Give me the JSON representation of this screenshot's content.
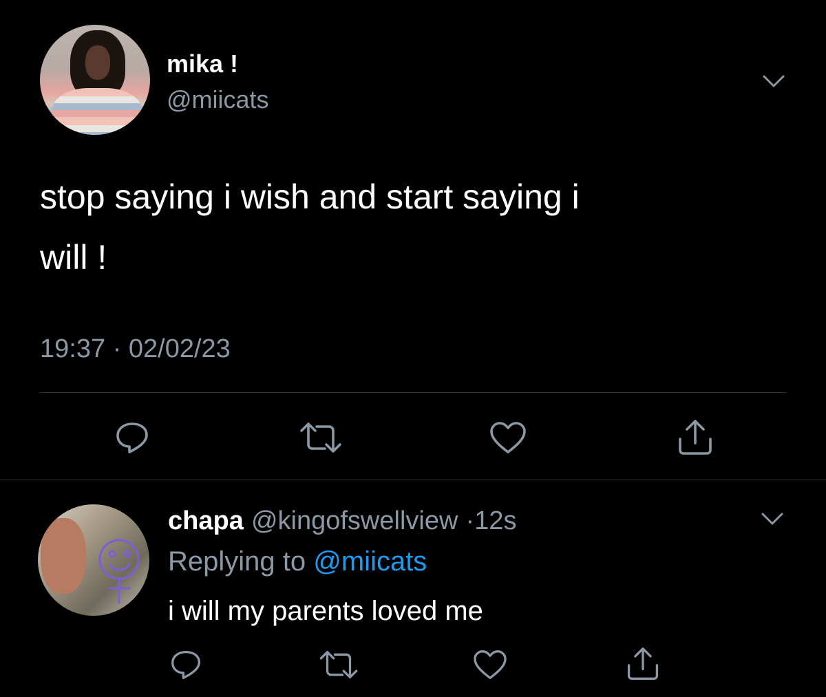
{
  "tweet": {
    "author_name": "mika !",
    "author_handle": "@miicats",
    "text_line1": "stop saying i wish and start saying i",
    "text_line2": "will !",
    "timestamp": "19:37 · 02/02/23"
  },
  "reply": {
    "author_name": "chapa",
    "author_handle": "@kingofswellview",
    "time_separator": "·",
    "time_ago": "12s",
    "replying_prefix": "Replying to",
    "replying_handle": "@miicats",
    "text": "i will my parents loved me"
  },
  "icons": {
    "reply": "reply-icon",
    "retweet": "retweet-icon",
    "like": "heart-icon",
    "share": "share-icon",
    "more": "chevron-down-icon"
  },
  "colors": {
    "background": "#000000",
    "text": "#ffffff",
    "secondary_text": "#8b98a5",
    "link": "#1d9bf0",
    "divider": "#2f3336"
  }
}
